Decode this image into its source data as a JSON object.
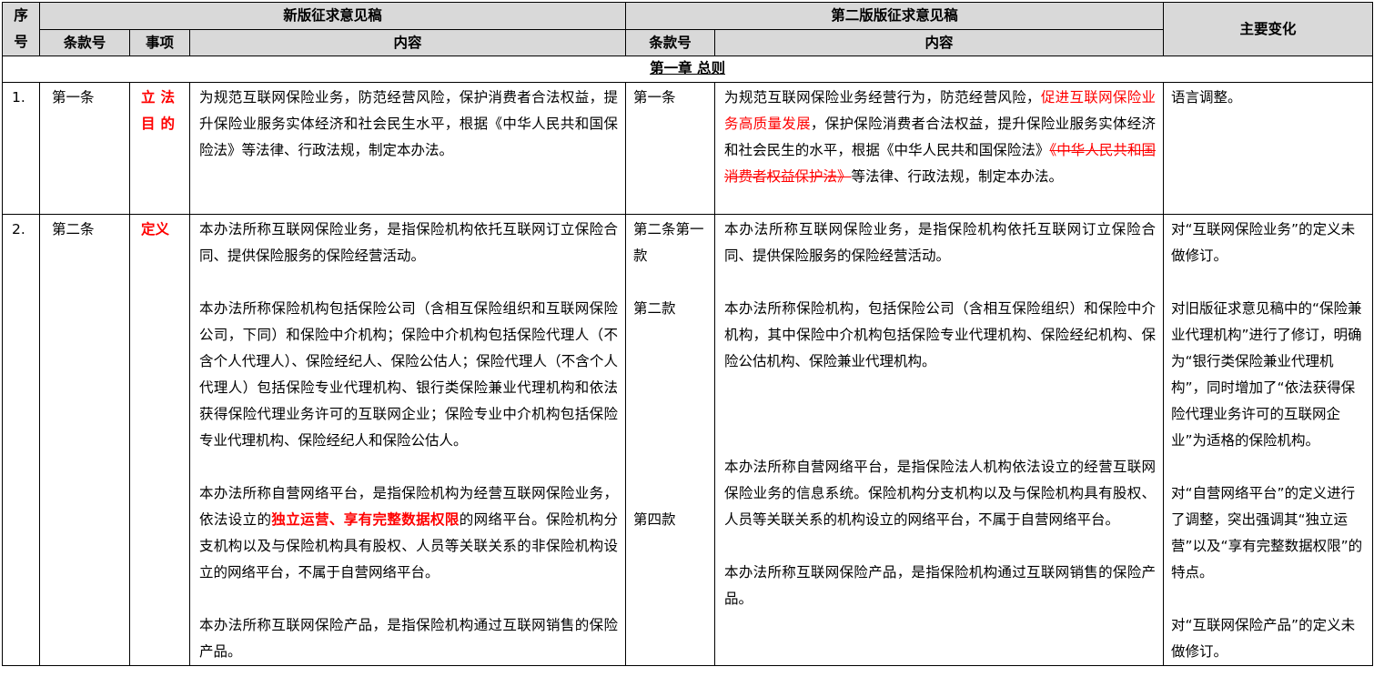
{
  "header": {
    "seq_label": "序号",
    "new_draft_title": "新版征求意见稿",
    "old_draft_title": "第二版版征求意见稿",
    "changes_label": "主要变化",
    "new_clause_label": "条款号",
    "new_topic_label": "事项",
    "new_content_label": "内容",
    "old_clause_label": "条款号",
    "old_content_label": "内容"
  },
  "chapter": {
    "title": "第一章 总则"
  },
  "rows": [
    {
      "seq": "1.",
      "new_clause": "第一条",
      "topic": "立法目的",
      "new_content": "为规范互联网保险业务，防范经营风险，保护消费者合法权益，提升保险业服务实体经济和社会民生水平，根据《中华人民共和国保险法》等法律、行政法规，制定本办法。",
      "old_clause": "第一条",
      "old_content": {
        "part1": "为规范互联网保险业务经营行为，防范经营风险，",
        "red1": "促进互联网保险业务高质量发展",
        "part2": "，保护保险消费者合法权益，提升保险业服务实体经济和社会民生的水平，根据《中华人民共和国保险法》",
        "struck": "《中华人民共和国消费者权益保护法》",
        "part3": "等法律、行政法规，制定本办法。"
      },
      "change": "语言调整。"
    },
    {
      "seq": "2.",
      "new_clause": "第二条",
      "topic": "定义",
      "new_p1": "本办法所称互联网保险业务，是指保险机构依托互联网订立保险合同、提供保险服务的保险经营活动。",
      "new_p2": "本办法所称保险机构包括保险公司（含相互保险组织和互联网保险公司，下同）和保险中介机构；保险中介机构包括保险代理人（不含个人代理人）、保险经纪人、保险公估人；保险代理人（不含个人代理人）包括保险专业代理机构、银行类保险兼业代理机构和依法获得保险代理业务许可的互联网企业；保险专业中介机构包括保险专业代理机构、保险经纪人和保险公估人。",
      "new_p3a": "本办法所称自营网络平台，是指保险机构为经营互联网保险业务，依法设立的",
      "new_p3_red": "独立运营、享有完整数据权限",
      "new_p3b": "的网络平台。保险机构分支机构以及与保险机构具有股权、人员等关联关系的非保险机构设立的网络平台，不属于自营网络平台。",
      "new_p4": "本办法所称互联网保险产品，是指保险机构通过互联网销售的保险产品。",
      "old_clause_1": "第二条第一款",
      "old_clause_2": "第二款",
      "old_clause_4": "第四款",
      "old_p1": "本办法所称互联网保险业务，是指保险机构依托互联网订立保险合同、提供保险服务的保险经营活动。",
      "old_p2": "本办法所称保险机构，包括保险公司（含相互保险组织）和保险中介机构，其中保险中介机构包括保险专业代理机构、保险经纪机构、保险公估机构、保险兼业代理机构。",
      "old_p3": "本办法所称自营网络平台，是指保险法人机构依法设立的经营互联网保险业务的信息系统。保险机构分支机构以及与保险机构具有股权、人员等关联关系的机构设立的网络平台，不属于自营网络平台。",
      "old_p4": "本办法所称互联网保险产品，是指保险机构通过互联网销售的保险产品。",
      "change_1": "对“互联网保险业务”的定义未做修订。",
      "change_2": "对旧版征求意见稿中的“保险兼业代理机构”进行了修订，明确为“银行类保险兼业代理机构”，同时增加了“依法获得保险代理业务许可的互联网企业”为适格的保险机构。",
      "change_3": "对“自营网络平台”的定义进行了调整，突出强调其“独立运营”以及“享有完整数据权限”的特点。",
      "change_4": "对“互联网保险产品”的定义未做修订。"
    }
  ]
}
